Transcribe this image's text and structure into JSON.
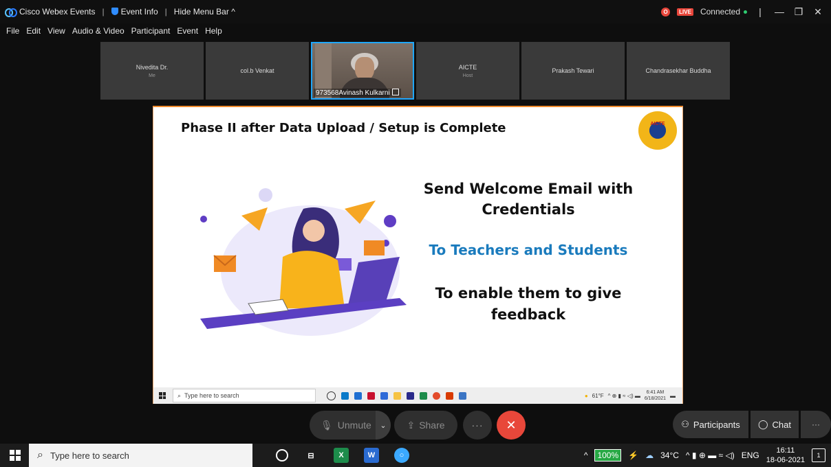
{
  "titlebar": {
    "app_name": "Cisco Webex Events",
    "event_info": "Event Info",
    "hide_menu": "Hide Menu Bar",
    "live": "LIVE",
    "connected": "Connected"
  },
  "menu": [
    "File",
    "Edit",
    "View",
    "Audio & Video",
    "Participant",
    "Event",
    "Help"
  ],
  "participants": [
    {
      "name": "Nivedita Dr.",
      "sub": "Me"
    },
    {
      "name": "col.b Venkat",
      "sub": ""
    },
    {
      "name": "973568Avinash Kulkarni",
      "sub": "",
      "active": true
    },
    {
      "name": "AICTE",
      "sub": "Host"
    },
    {
      "name": "Prakash Tewari",
      "sub": ""
    },
    {
      "name": "Chandrasekhar Buddha",
      "sub": ""
    }
  ],
  "slide": {
    "title": "Phase II after Data Upload / Setup is Complete",
    "logo_text": "AICTE",
    "line1": "Send Welcome Email with Credentials",
    "line2": "To Teachers and Students",
    "line3": "To enable them to give feedback",
    "inner_taskbar": {
      "search": "Type here to search",
      "temp": "61°F",
      "time": "6:41 AM",
      "date": "6/18/2021"
    }
  },
  "controls": {
    "unmute": "Unmute",
    "share": "Share",
    "participants": "Participants",
    "chat": "Chat"
  },
  "taskbar": {
    "search": "Type here to search",
    "battery": "100%",
    "temp": "34°C",
    "lang": "ENG",
    "time": "16:11",
    "date": "18-06-2021",
    "notifications": "1"
  },
  "colors": {
    "accent": "#1fa7ff",
    "end_call": "#e8473a",
    "slide_blue": "#1a7bbd"
  }
}
